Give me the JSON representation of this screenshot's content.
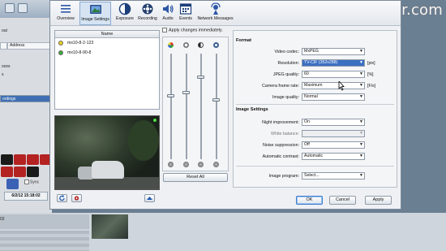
{
  "watermark": "©mxinstaller.com",
  "background_app": {
    "rows": [
      "out",
      "",
      "Address",
      "",
      "oces",
      "s",
      "",
      "ordings"
    ],
    "date": "6/2/12 15:18:02",
    "sync": "Sync",
    "timecode": "02"
  },
  "toolbar": {
    "items": [
      {
        "label": "Overview",
        "icon": "overview-icon"
      },
      {
        "label": "Image Settings",
        "icon": "image-settings-icon"
      },
      {
        "label": "Exposure",
        "icon": "exposure-icon"
      },
      {
        "label": "Recording",
        "icon": "recording-icon"
      },
      {
        "label": "Audio",
        "icon": "audio-icon"
      },
      {
        "label": "Events",
        "icon": "events-icon"
      },
      {
        "label": "Network Messages",
        "icon": "network-messages-icon"
      }
    ]
  },
  "camera_list": {
    "header": "Name",
    "cameras": [
      {
        "name": "mx10-8-2-123",
        "status_color": "#e8d21e"
      },
      {
        "name": "mx10-8-90-8",
        "status_color": "#3daa3d"
      }
    ]
  },
  "sliders": {
    "apply_label": "Apply changes immediately.",
    "reset_label": "Reset All",
    "levels": [
      0.6,
      0.63,
      0.78,
      0.56
    ]
  },
  "format": {
    "title": "Format",
    "rows": [
      {
        "label": "Video codec:",
        "value": "MxPEG",
        "unit": ""
      },
      {
        "label": "Resolution:",
        "value": "TV-CIF (352x288)",
        "unit": "[pix]",
        "highlight": true
      },
      {
        "label": "JPEG quality:",
        "value": "60",
        "unit": "[%]"
      },
      {
        "label": "Camera frame rate:",
        "value": "Maximum",
        "unit": "[F/s]"
      },
      {
        "label": "Image quality:",
        "value": "Normal",
        "unit": ""
      }
    ]
  },
  "image_settings": {
    "title": "Image Settings",
    "rows": [
      {
        "label": "Night improvement:",
        "value": "On"
      },
      {
        "label": "White balance:",
        "value": "",
        "disabled": true
      },
      {
        "label": "Noise suppression:",
        "value": "Off"
      },
      {
        "label": "Automatic contrast:",
        "value": "Automatic"
      }
    ]
  },
  "program": {
    "label": "Image program:",
    "value": "Select..."
  },
  "buttons": {
    "ok": "OK",
    "cancel": "Cancel",
    "apply": "Apply"
  }
}
